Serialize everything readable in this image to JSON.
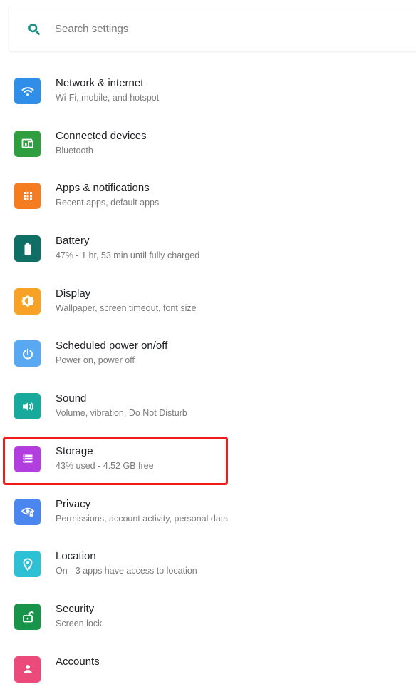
{
  "search": {
    "placeholder": "Search settings",
    "icon": "search-icon",
    "icon_color": "#1a8f83"
  },
  "settings": [
    {
      "title": "Network & internet",
      "subtitle": "Wi-Fi, mobile, and hotspot",
      "icon": "wifi-icon",
      "color": "#2f8fe8"
    },
    {
      "title": "Connected devices",
      "subtitle": "Bluetooth",
      "icon": "devices-icon",
      "color": "#2e9e3f"
    },
    {
      "title": "Apps & notifications",
      "subtitle": "Recent apps, default apps",
      "icon": "apps-icon",
      "color": "#f57c1f"
    },
    {
      "title": "Battery",
      "subtitle": "47% - 1 hr, 53 min until fully charged",
      "icon": "battery-icon",
      "color": "#0f6f64"
    },
    {
      "title": "Display",
      "subtitle": "Wallpaper, screen timeout, font size",
      "icon": "brightness-icon",
      "color": "#f7a226"
    },
    {
      "title": "Scheduled power on/off",
      "subtitle": "Power on, power off",
      "icon": "power-icon",
      "color": "#58a9f1"
    },
    {
      "title": "Sound",
      "subtitle": "Volume, vibration, Do Not Disturb",
      "icon": "volume-icon",
      "color": "#16a99c"
    },
    {
      "title": "Storage",
      "subtitle": "43% used - 4.52 GB free",
      "icon": "storage-icon",
      "color": "#b33ee0"
    },
    {
      "title": "Privacy",
      "subtitle": "Permissions, account activity, personal data",
      "icon": "privacy-icon",
      "color": "#4b86f0"
    },
    {
      "title": "Location",
      "subtitle": "On - 3 apps have access to location",
      "icon": "location-icon",
      "color": "#2ec0d4"
    },
    {
      "title": "Security",
      "subtitle": "Screen lock",
      "icon": "lock-icon",
      "color": "#17934a"
    },
    {
      "title": "Accounts",
      "subtitle": "",
      "icon": "accounts-icon",
      "color": "#ec4a7b"
    }
  ],
  "highlight": {
    "target": "Storage",
    "color": "#f01c1c"
  }
}
